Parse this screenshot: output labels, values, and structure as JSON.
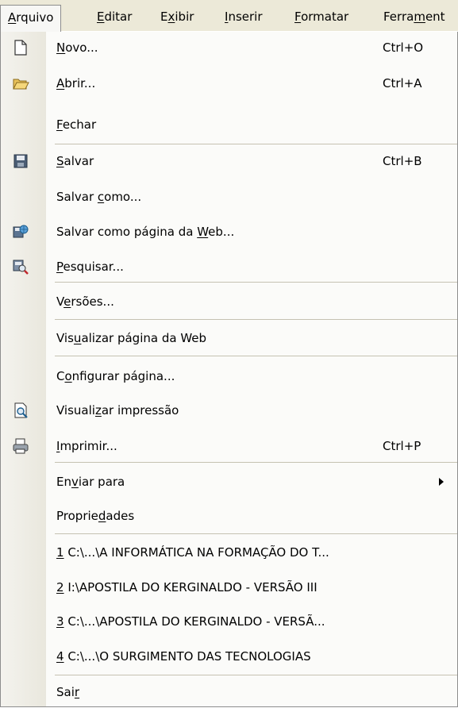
{
  "menubar": [
    {
      "before": "",
      "ul": "A",
      "after": "rquivo"
    },
    {
      "before": "",
      "ul": "E",
      "after": "ditar"
    },
    {
      "before": "E",
      "ul": "x",
      "after": "ibir"
    },
    {
      "before": "",
      "ul": "I",
      "after": "nserir"
    },
    {
      "before": "",
      "ul": "F",
      "after": "ormatar"
    },
    {
      "before": "Ferra",
      "ul": "m",
      "after": "ent"
    }
  ],
  "items": [
    {
      "before": "",
      "ul": "N",
      "after": "ovo...",
      "shortcut": "Ctrl+O",
      "icon": "new-document-icon"
    },
    {
      "before": "",
      "ul": "A",
      "after": "brir...",
      "shortcut": "Ctrl+A",
      "icon": "open-folder-icon"
    },
    {
      "before": "",
      "ul": "F",
      "after": "echar",
      "shortcut": "",
      "icon": ""
    },
    {
      "before": "",
      "ul": "S",
      "after": "alvar",
      "shortcut": "Ctrl+B",
      "icon": "save-disk-icon"
    },
    {
      "before": "Salvar ",
      "ul": "c",
      "after": "omo...",
      "shortcut": "",
      "icon": ""
    },
    {
      "before": "Salvar como página da ",
      "ul": "W",
      "after": "eb...",
      "shortcut": "",
      "icon": "save-as-web-page-icon"
    },
    {
      "before": "",
      "ul": "P",
      "after": "esquisar...",
      "shortcut": "",
      "icon": "search-file-icon"
    },
    {
      "before": "V",
      "ul": "e",
      "after": "rsões...",
      "shortcut": "",
      "icon": ""
    },
    {
      "before": "Vis",
      "ul": "u",
      "after": "alizar página da Web",
      "shortcut": "",
      "icon": ""
    },
    {
      "before": "C",
      "ul": "o",
      "after": "nfigurar página...",
      "shortcut": "",
      "icon": ""
    },
    {
      "before": "Visuali",
      "ul": "z",
      "after": "ar impressão",
      "shortcut": "",
      "icon": "print-preview-icon"
    },
    {
      "before": "",
      "ul": "I",
      "after": "mprimir...",
      "shortcut": "Ctrl+P",
      "icon": "printer-icon"
    },
    {
      "before": "En",
      "ul": "v",
      "after": "iar para",
      "shortcut": "",
      "icon": "",
      "submenu": true
    },
    {
      "before": "Proprie",
      "ul": "d",
      "after": "ades",
      "shortcut": "",
      "icon": ""
    },
    {
      "before": "",
      "ul": "1",
      "after": " C:\\...\\A INFORMÁTICA NA FORMAÇÃO DO T...",
      "shortcut": "",
      "icon": ""
    },
    {
      "before": "",
      "ul": "2",
      "after": " I:\\APOSTILA DO KERGINALDO - VERSÃO III",
      "shortcut": "",
      "icon": ""
    },
    {
      "before": "",
      "ul": "3",
      "after": " C:\\...\\APOSTILA DO KERGINALDO - VERSÃ...",
      "shortcut": "",
      "icon": ""
    },
    {
      "before": "",
      "ul": "4",
      "after": " C:\\...\\O SURGIMENTO DAS TECNOLOGIAS",
      "shortcut": "",
      "icon": ""
    },
    {
      "before": "Sai",
      "ul": "r",
      "after": "",
      "shortcut": "",
      "icon": ""
    }
  ],
  "colors": {
    "menubar_bg": "#ece9d8",
    "gutter": "#e9e7dd",
    "separator": "#c5c2b2"
  }
}
